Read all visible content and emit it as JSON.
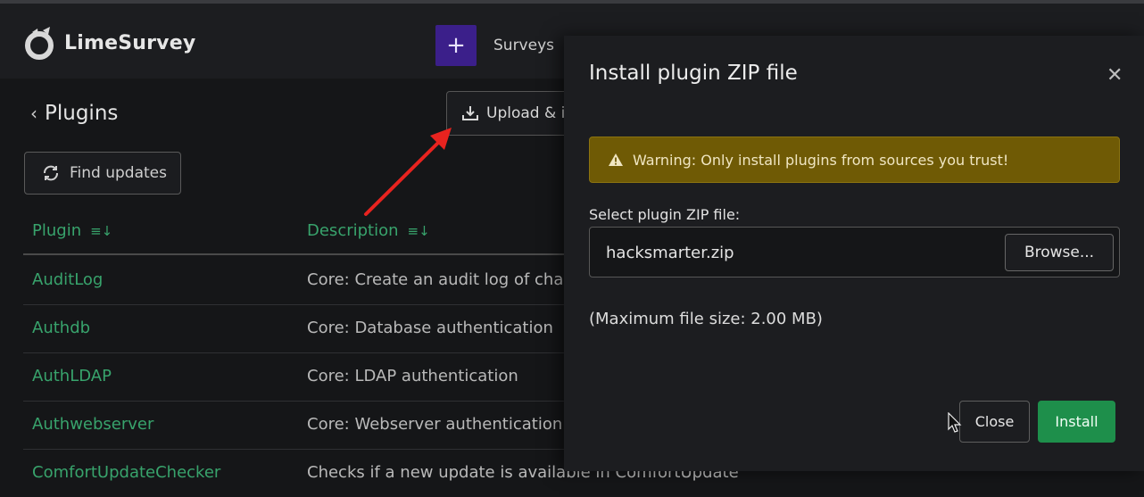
{
  "app": {
    "brand": "LimeSurvey"
  },
  "topnav": {
    "add_label": "+",
    "surveys_label": "Surveys"
  },
  "page": {
    "title": "Plugins",
    "upload_button": "Upload & i",
    "find_updates_button": "Find updates"
  },
  "table": {
    "columns": [
      "Plugin",
      "Description"
    ],
    "rows": [
      {
        "name": "AuditLog",
        "description": "Core: Create an audit log of cha"
      },
      {
        "name": "Authdb",
        "description": "Core: Database authentication"
      },
      {
        "name": "AuthLDAP",
        "description": "Core: LDAP authentication"
      },
      {
        "name": "Authwebserver",
        "description": "Core: Webserver authentication"
      },
      {
        "name": "ComfortUpdateChecker",
        "description": "Checks if a new update is available in ComfortUpdate"
      }
    ]
  },
  "modal": {
    "title": "Install plugin ZIP file",
    "warning": "Warning: Only install plugins from sources you trust!",
    "field_label": "Select plugin ZIP file:",
    "file_value": "hacksmarter.zip",
    "browse_label": "Browse...",
    "max_size": "(Maximum file size: 2.00 MB)",
    "close_label": "Close",
    "install_label": "Install"
  },
  "colors": {
    "accent_green": "#38a36c",
    "install_green": "#1e8f4b",
    "warning_bg": "#6f5a05",
    "add_purple": "#3b1f8a",
    "annotation_red": "#e8231f"
  }
}
